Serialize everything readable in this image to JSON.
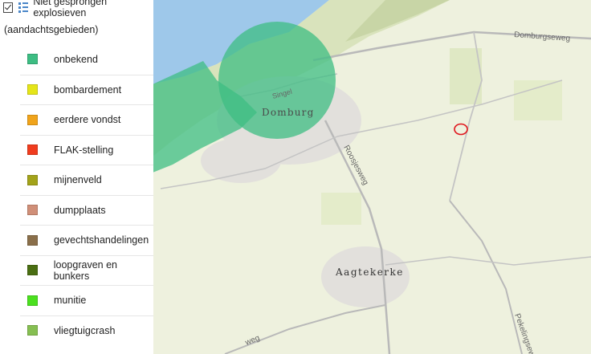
{
  "layer": {
    "title": "Niet gesprongen explosieven",
    "subtitle": "(aandachtsgebieden)",
    "checked": true,
    "layer_icon": "layer-list-icon"
  },
  "legend_items": [
    {
      "label": "onbekend",
      "color": "#3dbd83"
    },
    {
      "label": "bombardement",
      "color": "#e5e519"
    },
    {
      "label": "eerdere vondst",
      "color": "#f0a41b"
    },
    {
      "label": "FLAK-stelling",
      "color": "#f03c1e"
    },
    {
      "label": "mijnenveld",
      "color": "#a3a31a"
    },
    {
      "label": "dumpplaats",
      "color": "#d08f78"
    },
    {
      "label": "gevechtshandelingen",
      "color": "#8a6f4a"
    },
    {
      "label": "loopgraven en bunkers",
      "color": "#4a6e12"
    },
    {
      "label": "munitie",
      "color": "#4be01f"
    },
    {
      "label": "vliegtuigcrash",
      "color": "#86bf52"
    }
  ],
  "map": {
    "places": [
      "Domburg",
      "Aagtekerke"
    ],
    "roads": [
      "Domburgseweg",
      "Roosjesweg",
      "Singel",
      "Pekelingseweg",
      "weg"
    ],
    "marker_icon": "red-circle-marker-icon"
  }
}
